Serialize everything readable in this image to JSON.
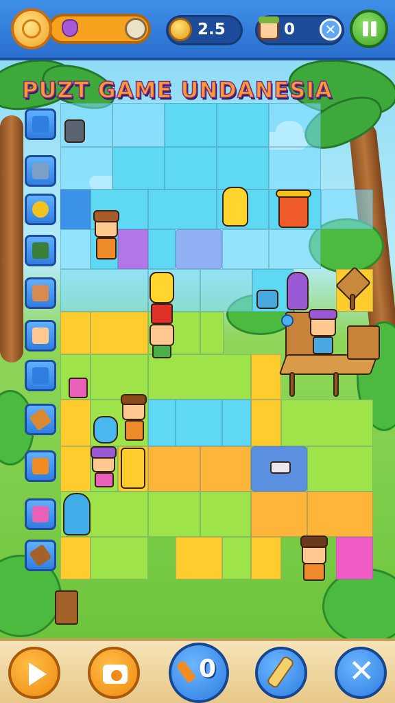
{
  "hud": {
    "energy_icon": "sun-icon",
    "gem_icon": "gem-icon",
    "coins": "2.5",
    "lives": "0",
    "close_icon": "x-icon",
    "pause_icon": "pause-icon"
  },
  "title": "PUZT GAME UNDANESIA",
  "sidebar": {
    "items": [
      {
        "icon": "blank-tile-icon"
      },
      {
        "icon": "cart-icon"
      },
      {
        "icon": "key-icon"
      },
      {
        "icon": "plank-icon"
      },
      {
        "icon": "villager-icon"
      },
      {
        "icon": "villager-icon"
      },
      {
        "icon": "blank-tile-icon"
      },
      {
        "icon": "log-icon"
      },
      {
        "icon": "carrots-icon"
      },
      {
        "icon": "villager-icon"
      },
      {
        "icon": "wood-icon"
      }
    ]
  },
  "toolbar": {
    "play_icon": "play-icon",
    "camera_icon": "camera-icon",
    "carrot_count": "0",
    "brush_icon": "brush-icon",
    "close_icon": "x-icon"
  },
  "colors": {
    "hud_blue": "#2a6fcf",
    "pause_green": "#3da427",
    "tile_yellow": "#ffcc2e",
    "tile_cyan": "#5fd8f4",
    "tile_pink": "#f05cc4"
  }
}
